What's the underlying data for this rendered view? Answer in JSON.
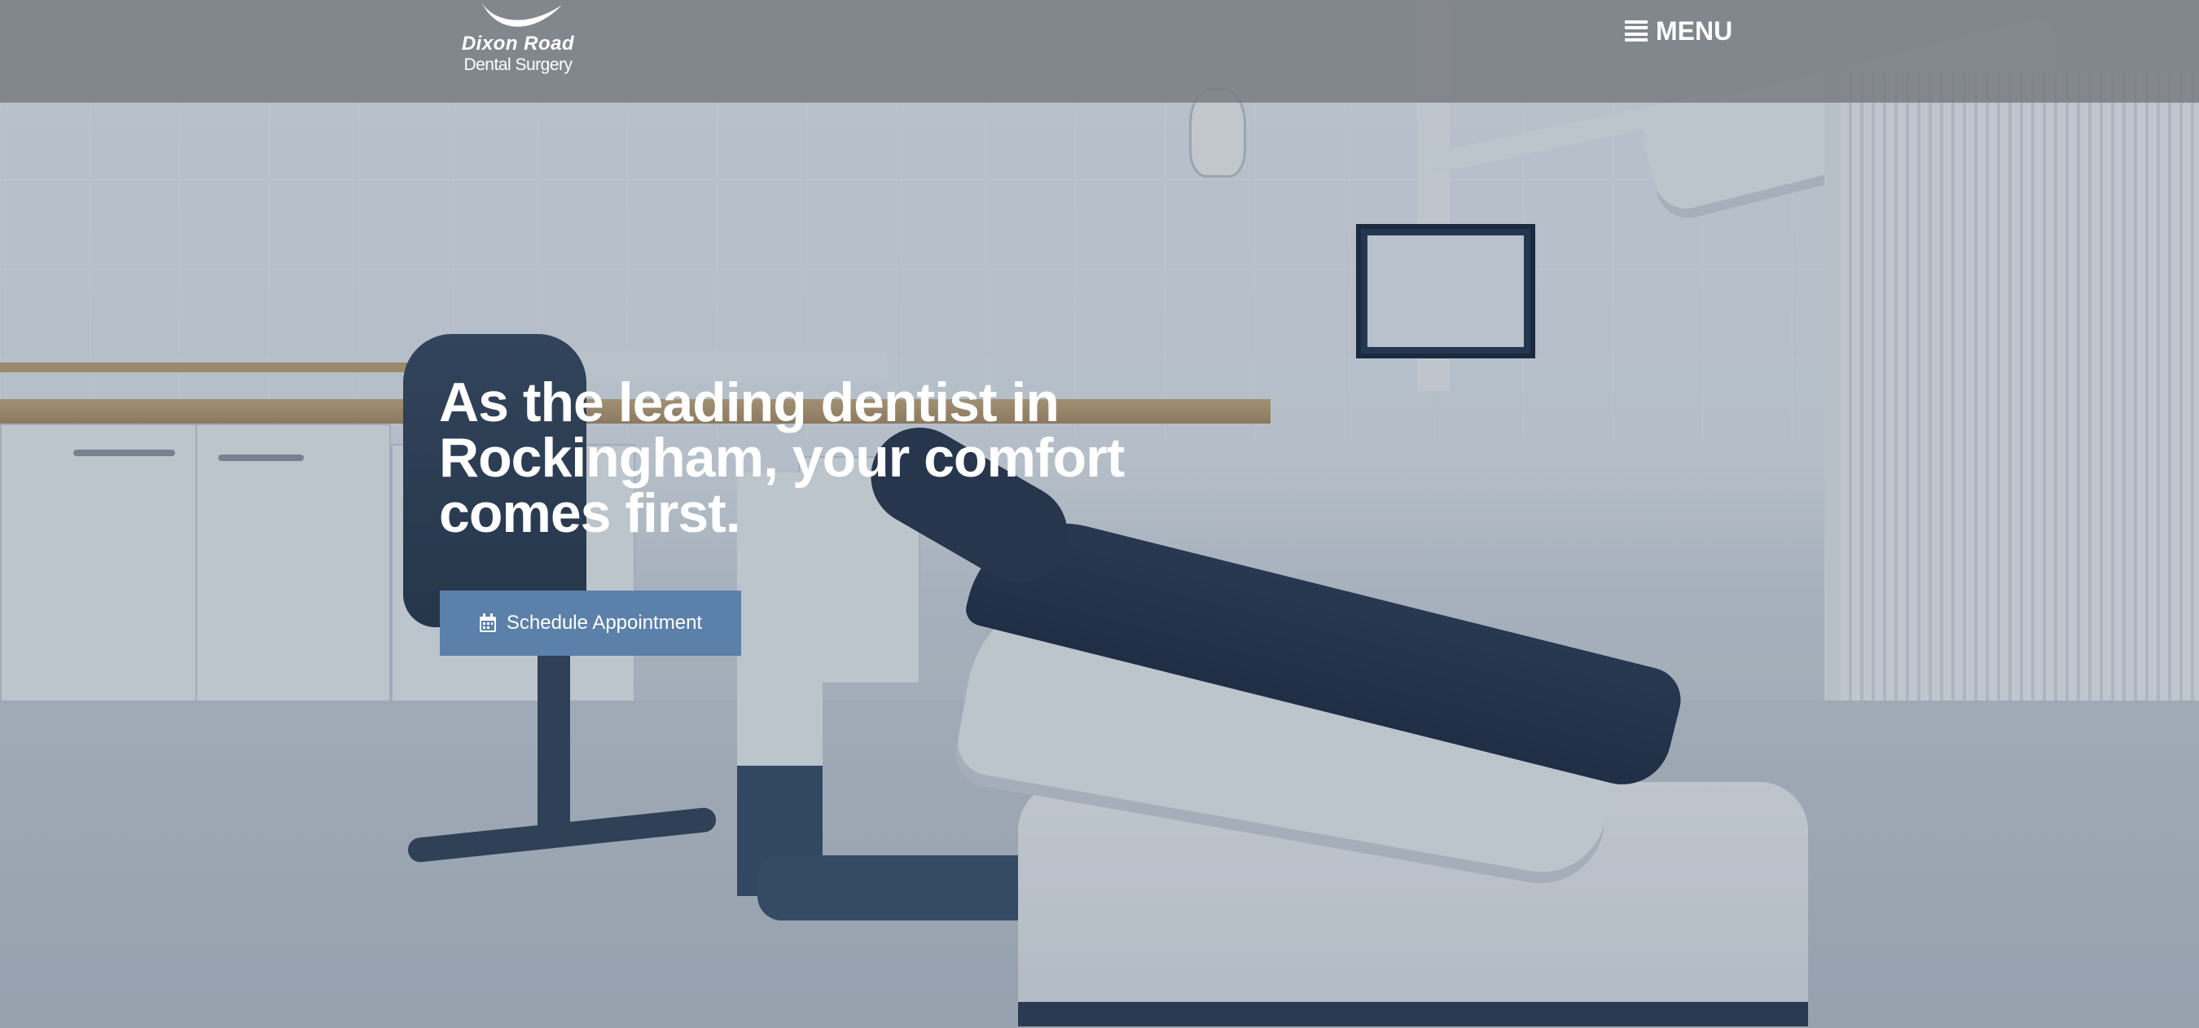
{
  "logo": {
    "line1": "Dixon Road",
    "line2": "Dental Surgery"
  },
  "nav": {
    "menu_label": "MENU",
    "menu_icon": "hamburger-icon"
  },
  "hero": {
    "headline": "As the leading dentist in Rockingham, your comfort comes first.",
    "cta_label": "Schedule Appointment",
    "cta_icon": "calendar-icon"
  },
  "colors": {
    "header_bg": "#767a80",
    "cta_bg": "#5b80a9",
    "text": "#ffffff"
  }
}
